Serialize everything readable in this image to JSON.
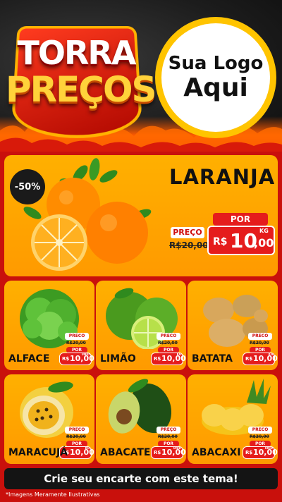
{
  "header": {
    "brand_line1": "TORRA",
    "brand_line2": "PREÇOS",
    "logo_line1": "Sua Logo",
    "logo_line2": "Aqui"
  },
  "featured": {
    "name": "LARANJA",
    "discount": "-50%",
    "old_label": "PREÇO",
    "old_price": "R$20,00",
    "new_label": "POR",
    "currency": "R$",
    "price_int": "10",
    "price_dec": ",00",
    "unit": "KG"
  },
  "products": [
    {
      "name": "ALFACE",
      "old_label": "PRECO",
      "old_price": "R$20,00",
      "new_label": "POR",
      "currency": "R$",
      "price": "10,00",
      "unit": "UNID"
    },
    {
      "name": "LIMÃO",
      "old_label": "PRECO",
      "old_price": "R$20,00",
      "new_label": "POR",
      "currency": "R$",
      "price": "10,00",
      "unit": "KG"
    },
    {
      "name": "BATATA",
      "old_label": "PRECO",
      "old_price": "R$20,00",
      "new_label": "POR",
      "currency": "R$",
      "price": "10,00",
      "unit": "KG"
    },
    {
      "name": "MARACUJÁ",
      "old_label": "PRECO",
      "old_price": "R$20,00",
      "new_label": "POR",
      "currency": "R$",
      "price": "10,00",
      "unit": "KG"
    },
    {
      "name": "ABACATE",
      "old_label": "PREÇO",
      "old_price": "R$20,00",
      "new_label": "POR",
      "currency": "R$",
      "price": "10,00",
      "unit": "UNID"
    },
    {
      "name": "ABACAXI",
      "old_label": "PRECO",
      "old_price": "R$20,00",
      "new_label": "POR",
      "currency": "R$",
      "price": "10,00",
      "unit": "UNID"
    }
  ],
  "footer": {
    "cta": "Crie seu encarte com este tema!",
    "disclaimer": "*Imagens Meramente Ilustrativas"
  },
  "colors": {
    "background_red": "#c9100c",
    "card_orange": "#ffa800",
    "price_red": "#e51c1c",
    "logo_ring": "#ffc400"
  }
}
